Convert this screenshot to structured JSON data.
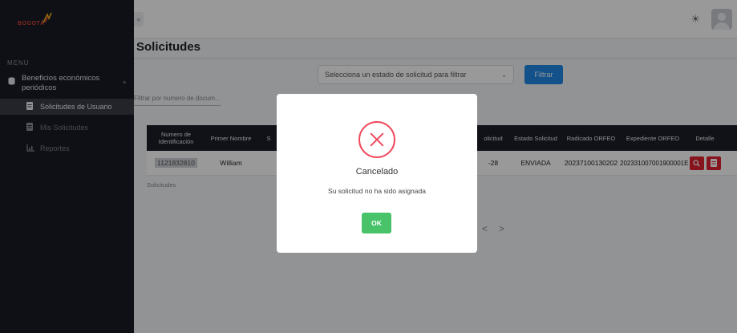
{
  "brand": {
    "logo_text": "BOGOTÁ"
  },
  "sidebar": {
    "menu_label": "MENU",
    "group": {
      "label": "Beneficios económicos periódicos",
      "chevron": "^"
    },
    "items": [
      {
        "label": "Solicitudes de Usuario",
        "icon": "file-icon",
        "active": true
      },
      {
        "label": "Mis Solicitudes",
        "icon": "file-icon",
        "active": false
      },
      {
        "label": "Reportes",
        "icon": "chart-icon",
        "active": false
      }
    ]
  },
  "topbar": {
    "collapse_glyph": "«",
    "theme_glyph": "☀"
  },
  "main": {
    "title": "Solicitudes",
    "select_placeholder": "Selecciona un estado de solicitud para filtrar",
    "filter_label": "Filtrar",
    "doc_filter_placeholder": "Filtrar por numero de docum...",
    "table": {
      "headers": {
        "id": "Numero de Identificación",
        "first_name": "Primer Nombre",
        "s": "S",
        "date": "olicitud",
        "status": "Estado Solicitud",
        "radicado": "Radicado ORFEO",
        "expediente": "Expediente ORFEO",
        "detail": "Detalle"
      },
      "row": {
        "id": "1121832810",
        "first_name": "William",
        "date": "-28",
        "status": "ENVIADA",
        "radicado": "20237100130202",
        "expediente": "202331007001900001E"
      }
    },
    "table_caption": "Solicitudes",
    "pager": {
      "prev": "<",
      "next": ">"
    }
  },
  "modal": {
    "title": "Cancelado",
    "message": "Su solicitud no ha sido asignada",
    "ok_label": "OK"
  },
  "colors": {
    "sidebar_bg": "#181b24",
    "primary": "#1e88e5",
    "danger": "#f04a5e",
    "success": "#49c36a"
  }
}
